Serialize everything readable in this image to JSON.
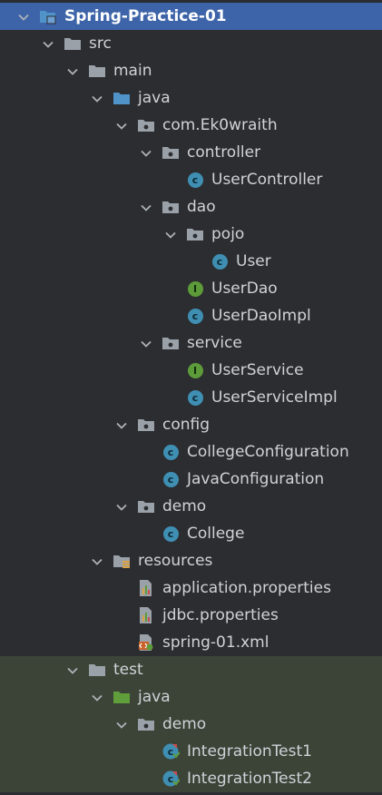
{
  "tree": {
    "items": [
      {
        "label": "Spring-Practice-01",
        "icon": "module-folder-icon",
        "name": "project-root"
      },
      {
        "label": "src",
        "icon": "folder-icon",
        "name": "folder-src"
      },
      {
        "label": "main",
        "icon": "folder-icon",
        "name": "folder-main"
      },
      {
        "label": "java",
        "icon": "source-root-icon",
        "name": "source-root-java"
      },
      {
        "label": "com.Ek0wraith",
        "icon": "package-icon",
        "name": "package-com-ek0wraith"
      },
      {
        "label": "controller",
        "icon": "package-icon",
        "name": "package-controller"
      },
      {
        "label": "UserController",
        "icon": "class-icon",
        "name": "class-usercontroller"
      },
      {
        "label": "dao",
        "icon": "package-icon",
        "name": "package-dao"
      },
      {
        "label": "pojo",
        "icon": "package-icon",
        "name": "package-pojo"
      },
      {
        "label": "User",
        "icon": "class-icon",
        "name": "class-user"
      },
      {
        "label": "UserDao",
        "icon": "interface-icon",
        "name": "interface-userdao"
      },
      {
        "label": "UserDaoImpl",
        "icon": "class-icon",
        "name": "class-userdaoimpl"
      },
      {
        "label": "service",
        "icon": "package-icon",
        "name": "package-service"
      },
      {
        "label": "UserService",
        "icon": "interface-icon",
        "name": "interface-userservice"
      },
      {
        "label": "UserServiceImpl",
        "icon": "class-icon",
        "name": "class-userserviceimpl"
      },
      {
        "label": "config",
        "icon": "package-icon",
        "name": "package-config"
      },
      {
        "label": "CollegeConfiguration",
        "icon": "class-icon",
        "name": "class-collegeconfiguration"
      },
      {
        "label": "JavaConfiguration",
        "icon": "class-icon",
        "name": "class-javaconfiguration"
      },
      {
        "label": "demo",
        "icon": "package-icon",
        "name": "package-demo"
      },
      {
        "label": "College",
        "icon": "class-icon",
        "name": "class-college"
      },
      {
        "label": "resources",
        "icon": "resources-root-icon",
        "name": "resources-root"
      },
      {
        "label": "application.properties",
        "icon": "properties-file-icon",
        "name": "file-application-properties"
      },
      {
        "label": "jdbc.properties",
        "icon": "properties-file-icon",
        "name": "file-jdbc-properties"
      },
      {
        "label": "spring-01.xml",
        "icon": "xml-file-icon",
        "name": "file-spring-01-xml"
      },
      {
        "label": "test",
        "icon": "folder-icon",
        "name": "folder-test"
      },
      {
        "label": "java",
        "icon": "test-source-root-icon",
        "name": "test-source-root-java"
      },
      {
        "label": "demo",
        "icon": "package-icon",
        "name": "test-package-demo"
      },
      {
        "label": "IntegrationTest1",
        "icon": "test-class-icon",
        "name": "class-integrationtest1"
      },
      {
        "label": "IntegrationTest2",
        "icon": "test-class-icon",
        "name": "class-integrationtest2"
      }
    ]
  },
  "colors": {
    "background": "#2b2d30",
    "selection": "#3d64a8",
    "test_area": "#3c4438",
    "text": "#cfd3d8",
    "class_icon": "#3f8fb3",
    "interface_icon": "#5d9b3a",
    "folder_icon": "#9aa1a9",
    "source_root_icon": "#4f93c8",
    "test_root_icon": "#5f9e3a"
  }
}
